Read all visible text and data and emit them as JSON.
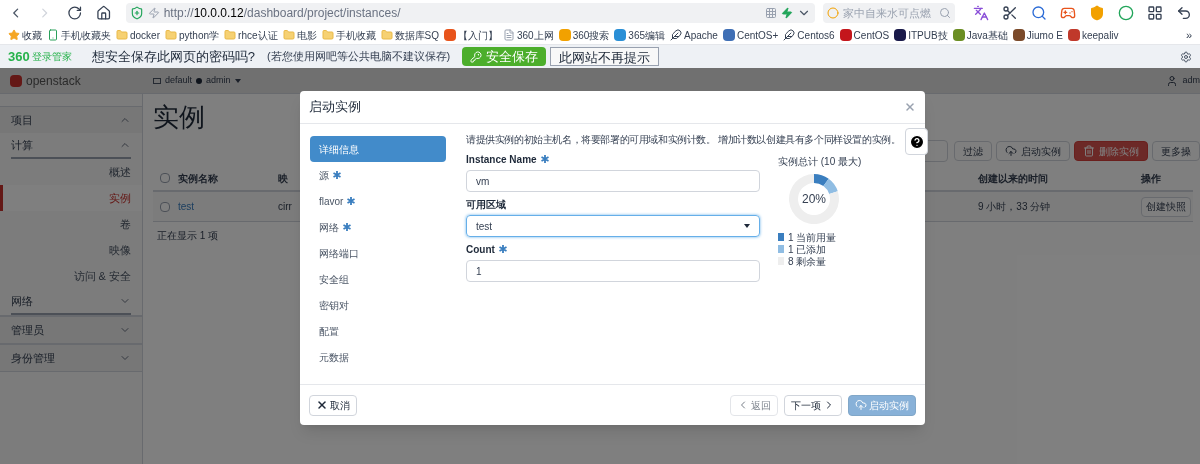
{
  "browser": {
    "url": "http://**10.0.0.12**/dashboard/project/instances/",
    "search_placeholder": "家中自来水可点燃"
  },
  "bookmarks": [
    {
      "label": "收藏",
      "kind": "star"
    },
    {
      "label": "手机收藏夹",
      "kind": "phone"
    },
    {
      "label": "docker",
      "kind": "folder"
    },
    {
      "label": "python学",
      "kind": "folder"
    },
    {
      "label": "rhce认证",
      "kind": "folder"
    },
    {
      "label": "电影",
      "kind": "folder"
    },
    {
      "label": "手机收藏",
      "kind": "folder"
    },
    {
      "label": "数据库SQ",
      "kind": "folder"
    },
    {
      "label": "【入门】",
      "kind": "site",
      "color": "#e8541c"
    },
    {
      "label": "360上网",
      "kind": "page"
    },
    {
      "label": "360搜索",
      "kind": "site",
      "color": "#f2a100"
    },
    {
      "label": "365编辑",
      "kind": "site",
      "color": "#2a8fd6"
    },
    {
      "label": "Apache",
      "kind": "feather"
    },
    {
      "label": "CentOS+",
      "kind": "site",
      "color": "#3f6fb5"
    },
    {
      "label": "Centos6",
      "kind": "feather"
    },
    {
      "label": "CentOS",
      "kind": "site",
      "color": "#c4161c"
    },
    {
      "label": "ITPUB技",
      "kind": "site",
      "color": "#1a1a4a"
    },
    {
      "label": "Java基础",
      "kind": "site",
      "color": "#6b8e23"
    },
    {
      "label": "Jiumo E",
      "kind": "site",
      "color": "#7b4a2a"
    },
    {
      "label": "keepaliv",
      "kind": "site",
      "color": "#c0392b"
    }
  ],
  "bookmarks_more": "»",
  "password_bar": {
    "brand_mark": "360",
    "brand_name": "登录管家",
    "prompt": "想安全保存此网页的密码吗?",
    "note": "(若您使用网吧等公共电脑不建议保存)",
    "save_button": "安全保存",
    "dismiss_button": "此网站不再提示"
  },
  "header": {
    "logo": "openstack",
    "project": "default",
    "user": "admin",
    "account": "adm"
  },
  "sidebar": [
    {
      "label": "项目",
      "expanded": true,
      "children": [
        {
          "label": "计算",
          "expanded": true,
          "children": [
            {
              "label": "概述",
              "selected": false
            },
            {
              "label": "实例",
              "selected": true
            },
            {
              "label": "卷",
              "selected": false
            },
            {
              "label": "映像",
              "selected": false
            },
            {
              "label": "访问 & 安全",
              "selected": false
            }
          ]
        },
        {
          "label": "网络",
          "expanded": false
        }
      ]
    },
    {
      "label": "管理员",
      "expanded": false
    },
    {
      "label": "身份管理",
      "expanded": false
    }
  ],
  "page": {
    "title": "实例",
    "actions": [
      {
        "label": "过滤",
        "kind": "plain"
      },
      {
        "label": "启动实例",
        "kind": "launch"
      },
      {
        "label": "删除实例",
        "kind": "danger"
      },
      {
        "label": "更多操",
        "kind": "plain"
      }
    ],
    "columns": {
      "name": "实例名称",
      "image": "映",
      "age": "创建以来的时间",
      "actions": "操作"
    },
    "select_all_checked": false,
    "rows": [
      {
        "checked": false,
        "name": "test",
        "image": "cirr",
        "age": "9 小时，33 分钟",
        "action": "创建快照"
      }
    ],
    "footer": "正在显示 1 项"
  },
  "modal": {
    "title": "启动实例",
    "steps": [
      {
        "label": "详细信息",
        "required": false,
        "selected": true
      },
      {
        "label": "源",
        "required": true,
        "selected": false
      },
      {
        "label": "flavor",
        "required": true,
        "selected": false
      },
      {
        "label": "网络",
        "required": true,
        "selected": false
      },
      {
        "label": "网络端口",
        "required": false,
        "selected": false
      },
      {
        "label": "安全组",
        "required": false,
        "selected": false
      },
      {
        "label": "密钥对",
        "required": false,
        "selected": false
      },
      {
        "label": "配置",
        "required": false,
        "selected": false
      },
      {
        "label": "元数据",
        "required": false,
        "selected": false
      }
    ],
    "description": "请提供实例的初始主机名，将要部署的可用域和实例计数。 增加计数以创建具有多个同样设置的实例。",
    "fields": [
      {
        "label": "Instance Name",
        "required": true,
        "kind": "text",
        "value": "vm",
        "focused": false
      },
      {
        "label": "可用区域",
        "required": false,
        "kind": "select",
        "value": "test",
        "focused": true
      },
      {
        "label": "Count",
        "required": true,
        "kind": "text",
        "value": "1",
        "focused": false
      }
    ],
    "quota": {
      "percent": "20%",
      "chart_data": {
        "type": "donut",
        "title": "实例总计 (10 最大)",
        "categories": [
          "当前用量",
          "已添加",
          "剩余量"
        ],
        "values": [
          1,
          1,
          8
        ],
        "data_labels": true,
        "legend": "bottom"
      }
    },
    "buttons": [
      {
        "label": "取消",
        "kind": "cancel",
        "disabled": false
      },
      {
        "label": "返回",
        "kind": "back",
        "disabled": true
      },
      {
        "label": "下一项",
        "kind": "next",
        "disabled": false
      },
      {
        "label": "启动实例",
        "kind": "launch",
        "disabled": true
      }
    ]
  }
}
